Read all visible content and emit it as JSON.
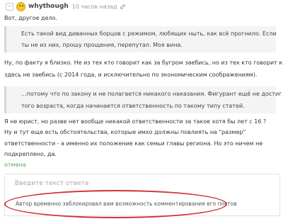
{
  "comment": {
    "collapse_symbol": "–",
    "avatar_icon": "smiley-face-icon",
    "username": "whythough",
    "time": "10 часов назад",
    "link_icon": "link-icon",
    "intro": "Вот, другое дело.",
    "quote1": {
      "lines": [
        "Есть такой вид диванных борцов с режимом, любящих ныть, как всё прогнило. Если",
        "ты не из них, прошу прощения, перепутал. Моя вина."
      ]
    },
    "paragraph1": [
      "Ну, по факту я близко. Не из тех кто говорит как за бугром заебись, но из тех кто говорит как",
      "здесь не заебись (с 2014 года, и исключительно по экономическим соображениям)."
    ],
    "quote2": {
      "lines": [
        "...потому что по закону и не полагается никакого наказания. Фигурант ещё не достиг",
        "того возраста, когда начинается ответственность по такому типу статей."
      ]
    },
    "paragraph2": [
      "Я не юрист, но разве нет вообще никакой ответственности за такое хотя бы лет с 16 ?",
      "Ну и тут еще есть обстоятельства, которые имхо должны повлиять на \"размер\"",
      "ответственности - а именно их положение как семьи главы региона. Но это ничем не",
      "подкреплено, да."
    ]
  },
  "reply": {
    "cancel_label": "отмена",
    "placeholder": "Введите текст ответа",
    "blocked_notice": "Автор временно заблокировал вам возможность комментирования его постов",
    "highlight_color": "#d63232"
  }
}
